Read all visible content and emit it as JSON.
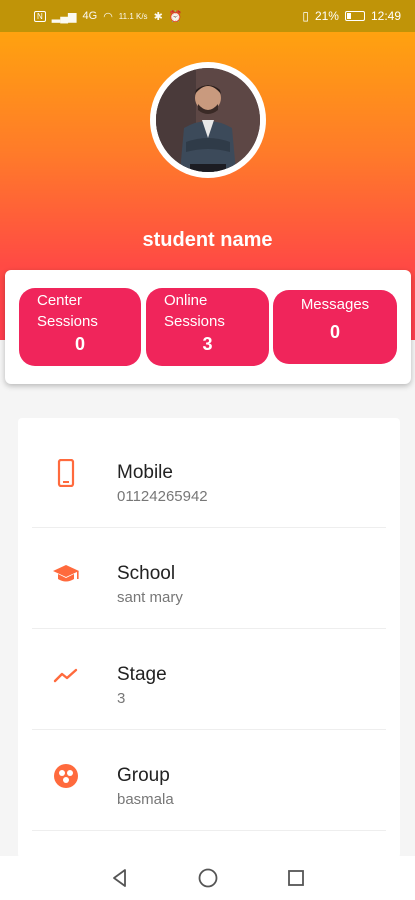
{
  "status_bar": {
    "left_badge": "N",
    "signal_text": "4G",
    "data_rate": "11.1 K/s",
    "battery_percent": "21%",
    "time": "12:49"
  },
  "profile": {
    "name": "student name"
  },
  "stats": [
    {
      "label_line1": "Center",
      "label_line2": "Sessions",
      "value": "0"
    },
    {
      "label_line1": "Online",
      "label_line2": "Sessions",
      "value": "3"
    },
    {
      "label_line1": "Messages",
      "label_line2": "",
      "value": "0"
    }
  ],
  "info": [
    {
      "title": "Mobile",
      "value": "01124265942",
      "icon": "phone-icon"
    },
    {
      "title": "School",
      "value": "sant mary",
      "icon": "graduation-cap-icon"
    },
    {
      "title": "Stage",
      "value": "3",
      "icon": "trending-up-icon"
    },
    {
      "title": "Group",
      "value": "basmala",
      "icon": "group-circle-icon"
    }
  ],
  "colors": {
    "accent": "#f0255b",
    "icon": "#ff6a3d",
    "header_top": "#ffa20f",
    "header_bottom": "#ff3d4f"
  }
}
